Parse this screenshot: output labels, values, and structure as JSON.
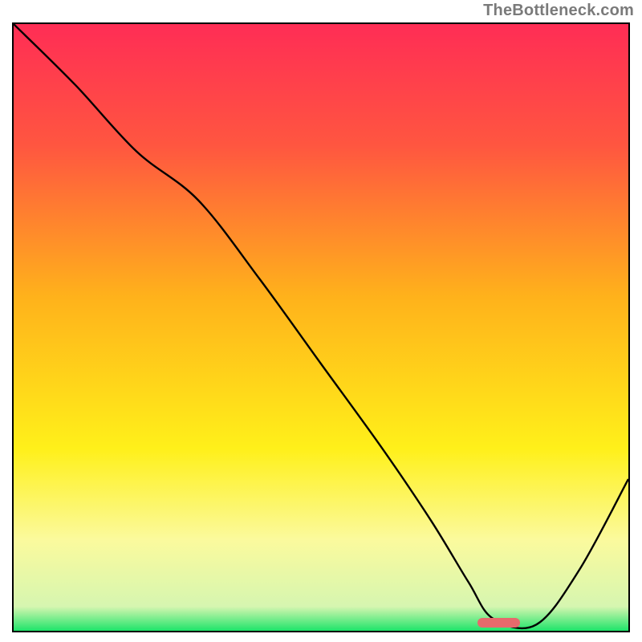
{
  "watermark": "TheBottleneck.com",
  "chart_data": {
    "type": "line",
    "title": "",
    "xlabel": "",
    "ylabel": "",
    "xlim": [
      0,
      100
    ],
    "ylim": [
      0,
      100
    ],
    "grid": false,
    "legend": false,
    "background_gradient": {
      "stops": [
        {
          "offset": 0,
          "color": "#ff2d55"
        },
        {
          "offset": 20,
          "color": "#ff5640"
        },
        {
          "offset": 45,
          "color": "#ffb21b"
        },
        {
          "offset": 70,
          "color": "#fff01a"
        },
        {
          "offset": 85,
          "color": "#fbfa9d"
        },
        {
          "offset": 96,
          "color": "#d6f6b0"
        },
        {
          "offset": 100,
          "color": "#1ee46a"
        }
      ]
    },
    "series": [
      {
        "name": "curve",
        "x": [
          0,
          10,
          20,
          30,
          40,
          50,
          60,
          68,
          74,
          78,
          85,
          92,
          100
        ],
        "y": [
          100,
          90,
          79,
          71,
          58,
          44,
          30,
          18,
          8,
          2,
          1,
          10,
          25
        ]
      }
    ],
    "annotations": [
      {
        "type": "marker",
        "shape": "rounded-rect",
        "color": "#e66a6c",
        "x_start": 75.5,
        "x_end": 82.5,
        "y": 1.2
      }
    ]
  }
}
